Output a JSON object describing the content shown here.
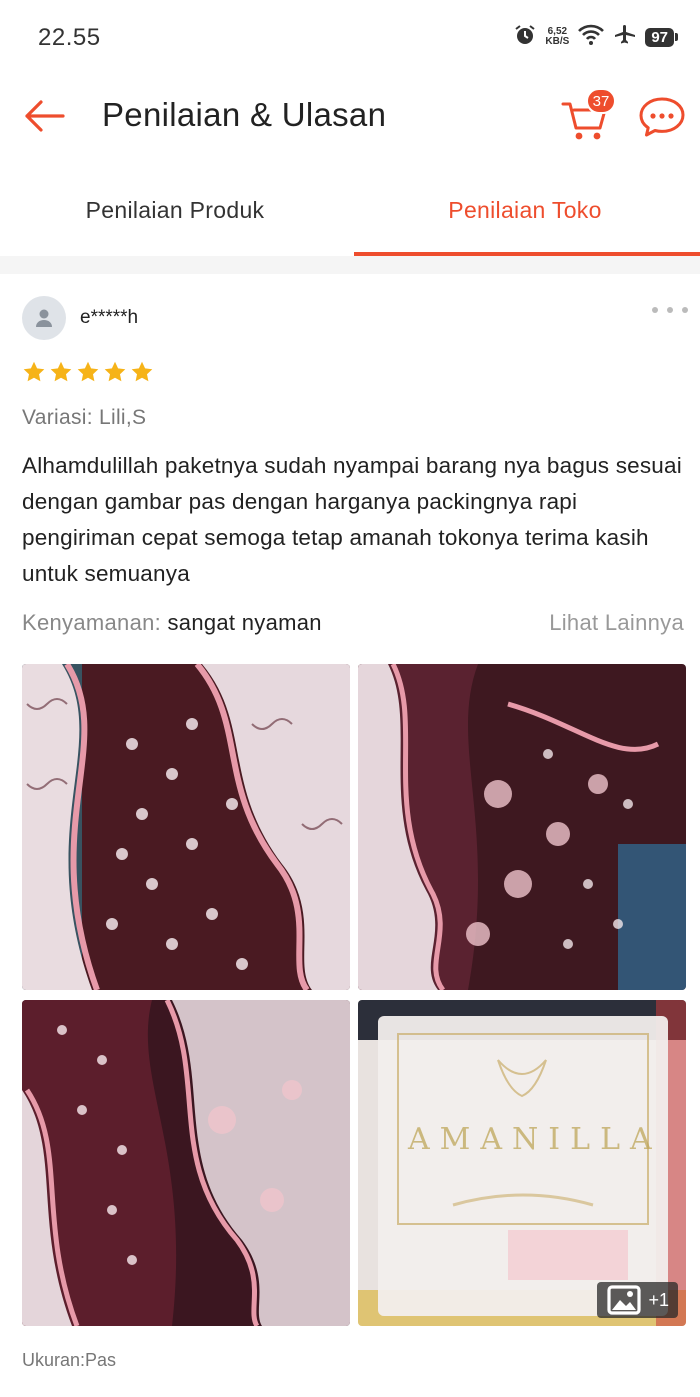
{
  "status_bar": {
    "time": "22.55",
    "net_speed_value": "6,52",
    "net_speed_unit": "KB/S",
    "battery": "97"
  },
  "header": {
    "title": "Penilaian & Ulasan",
    "cart_count": "37",
    "accent_color": "#ee4d2d"
  },
  "tabs": [
    {
      "label": "Penilaian Produk",
      "active": false
    },
    {
      "label": "Penilaian Toko",
      "active": true
    }
  ],
  "review": {
    "username": "e*****h",
    "rating": 5,
    "variation": "Variasi: Lili,S",
    "text": "Alhamdulillah paketnya sudah nyampai barang nya bagus sesuai dengan gambar pas dengan harganya packingnya rapi pengiriman cepat semoga tetap amanah tokonya terima kasih untuk semuanya",
    "comfort_label": "Kenyamanan:",
    "comfort_value": "sangat nyaman",
    "see_more": "Lihat Lainnya",
    "extra_photos": "+1",
    "packaging_brand": "AMANILLA",
    "size_label": "Ukuran:Pas"
  }
}
